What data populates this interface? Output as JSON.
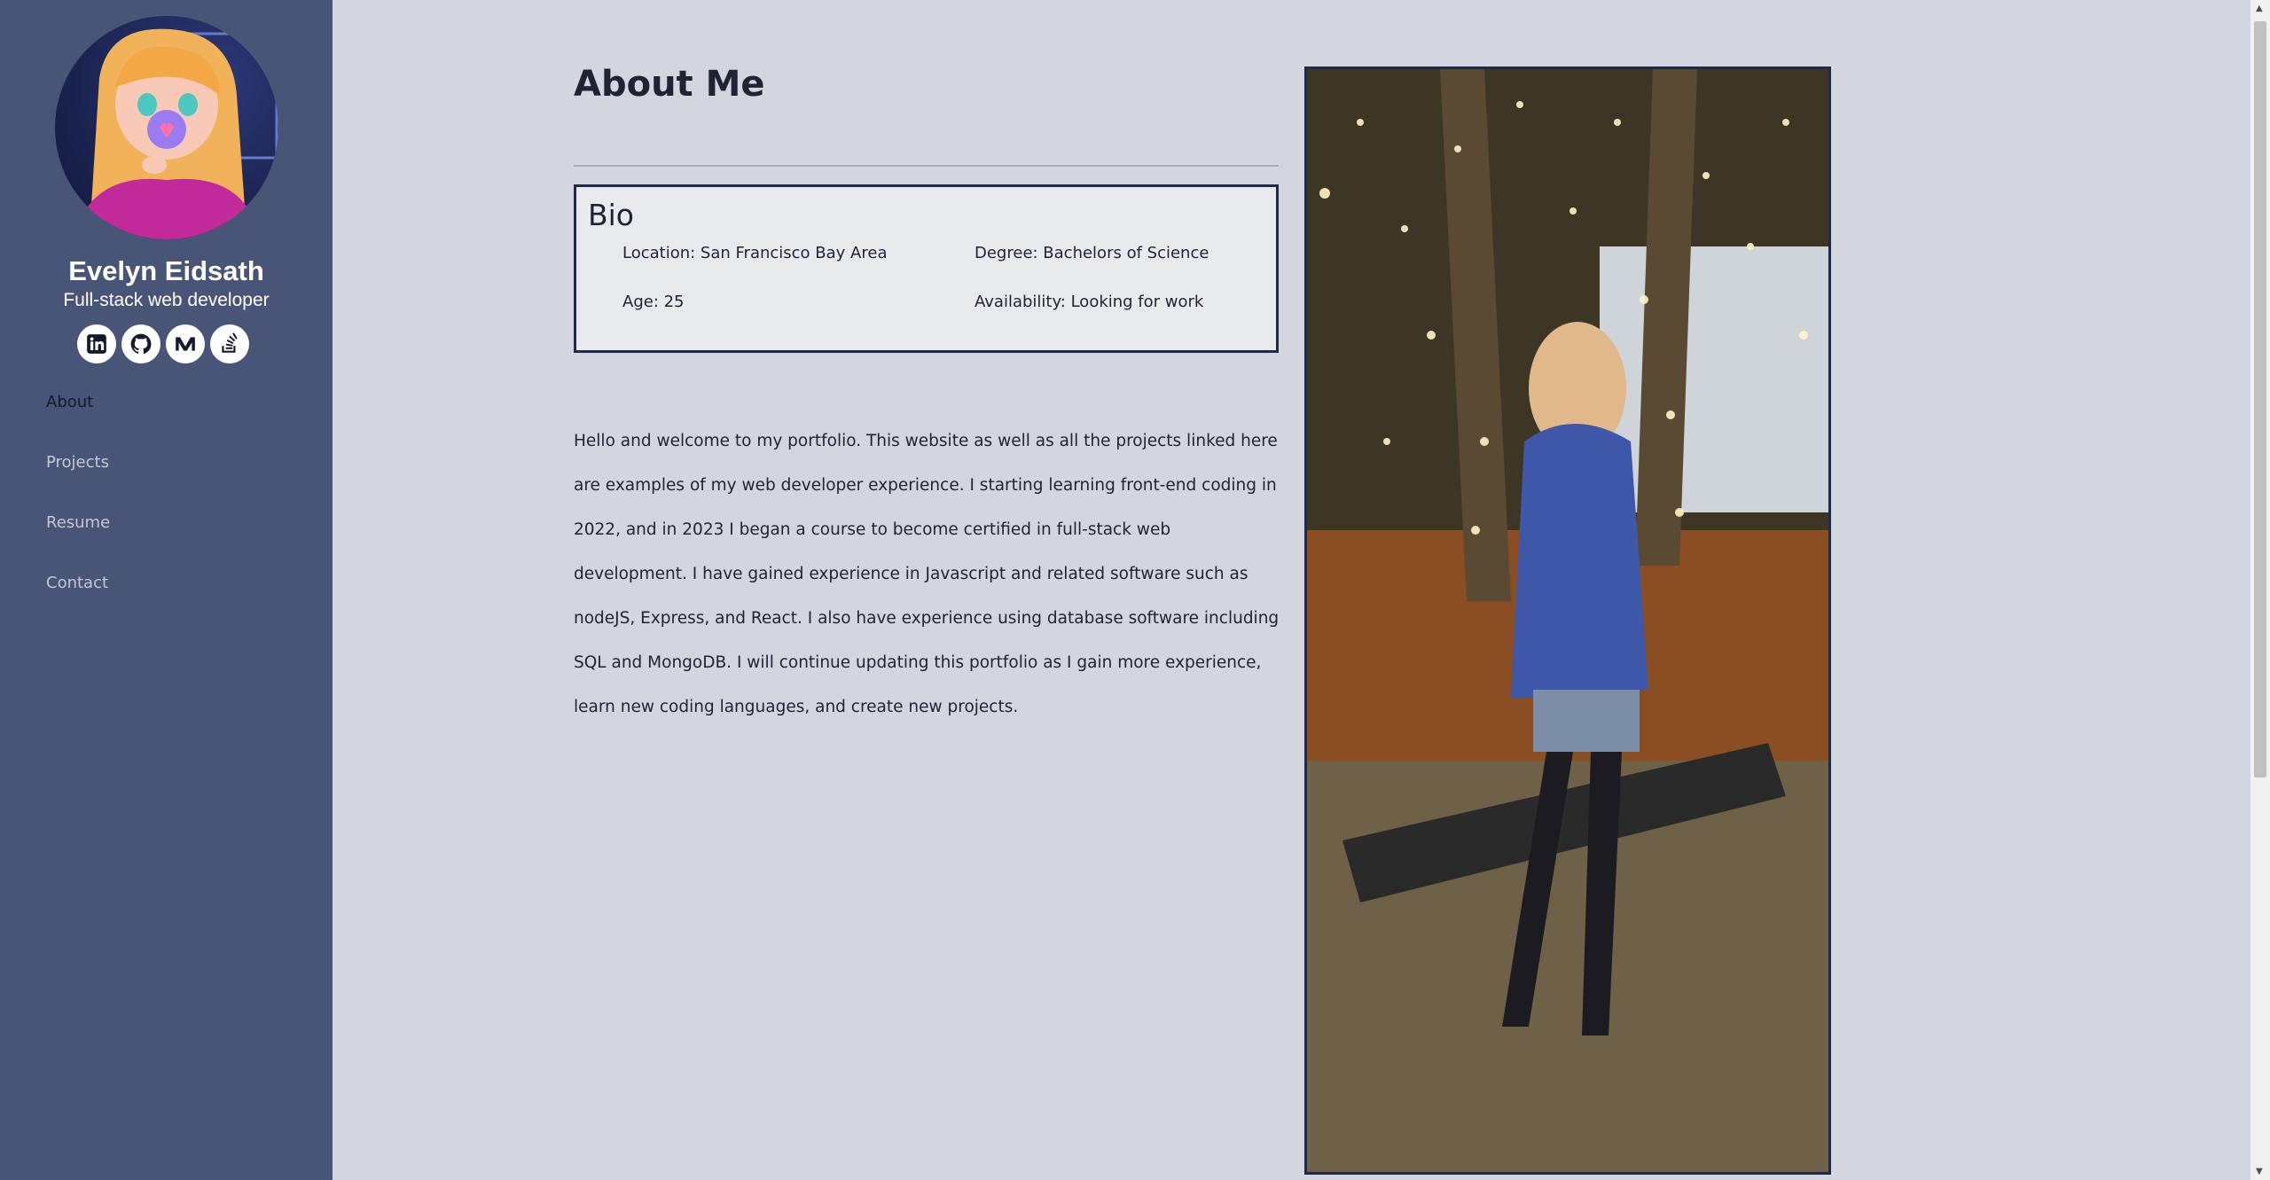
{
  "sidebar": {
    "name": "Evelyn Eidsath",
    "tagline": "Full-stack web developer",
    "socials": [
      "linkedin-icon",
      "github-icon",
      "medium-icon",
      "stackoverflow-icon"
    ],
    "nav": [
      {
        "label": "About",
        "active": true
      },
      {
        "label": "Projects",
        "active": false
      },
      {
        "label": "Resume",
        "active": false
      },
      {
        "label": "Contact",
        "active": false
      }
    ]
  },
  "main": {
    "title": "About Me",
    "bio": {
      "heading": "Bio",
      "location": "Location: San Francisco Bay Area",
      "degree": "Degree: Bachelors of Science",
      "age": "Age: 25",
      "availability": "Availability: Looking for work"
    },
    "paragraph": "Hello and welcome to my portfolio. This website as well as all the projects linked here are examples of my web developer experience. I starting learning front-end coding in 2022, and in 2023 I began a course to become certified in full-stack web development. I have gained experience in Javascript and related software such as nodeJS, Express, and React. I also have experience using database software including SQL and MongoDB. I will continue updating this portfolio as I gain more experience, learn new coding languages, and create new projects."
  },
  "colors": {
    "sidebar": "#495576",
    "page": "#d3d6de",
    "border": "#1d2a4a"
  }
}
